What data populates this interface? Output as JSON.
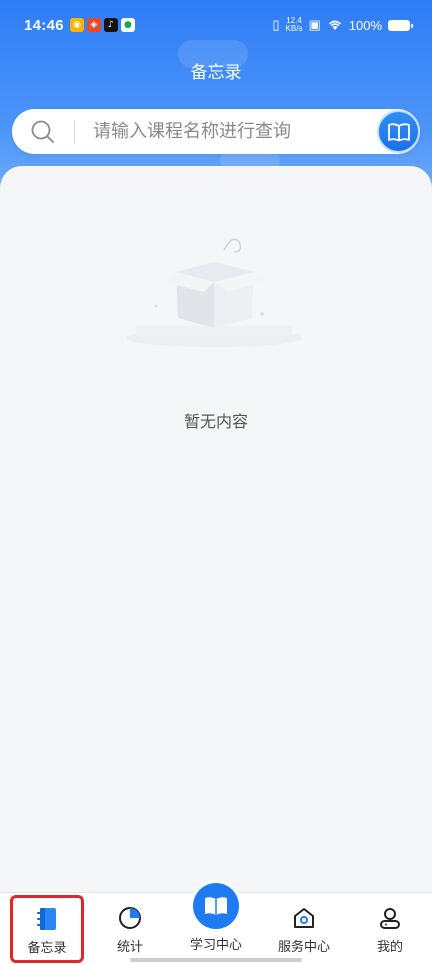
{
  "status_bar": {
    "time": "14:46",
    "net_speed_value": "12.4",
    "net_speed_unit": "KB/s",
    "battery": "100%"
  },
  "header": {
    "title": "备忘录"
  },
  "search": {
    "placeholder": "请输入课程名称进行查询"
  },
  "empty_state": {
    "message": "暂无内容"
  },
  "tabs": [
    {
      "label": "备忘录",
      "icon": "memo-book-icon",
      "active": true
    },
    {
      "label": "统计",
      "icon": "pie-chart-icon",
      "active": false
    },
    {
      "label": "学习中心",
      "icon": "open-book-icon",
      "active": false
    },
    {
      "label": "服务中心",
      "icon": "home-service-icon",
      "active": false
    },
    {
      "label": "我的",
      "icon": "user-icon",
      "active": false
    }
  ],
  "colors": {
    "brand_blue": "#2f7df6",
    "active_tab_highlight": "#e0262e"
  }
}
